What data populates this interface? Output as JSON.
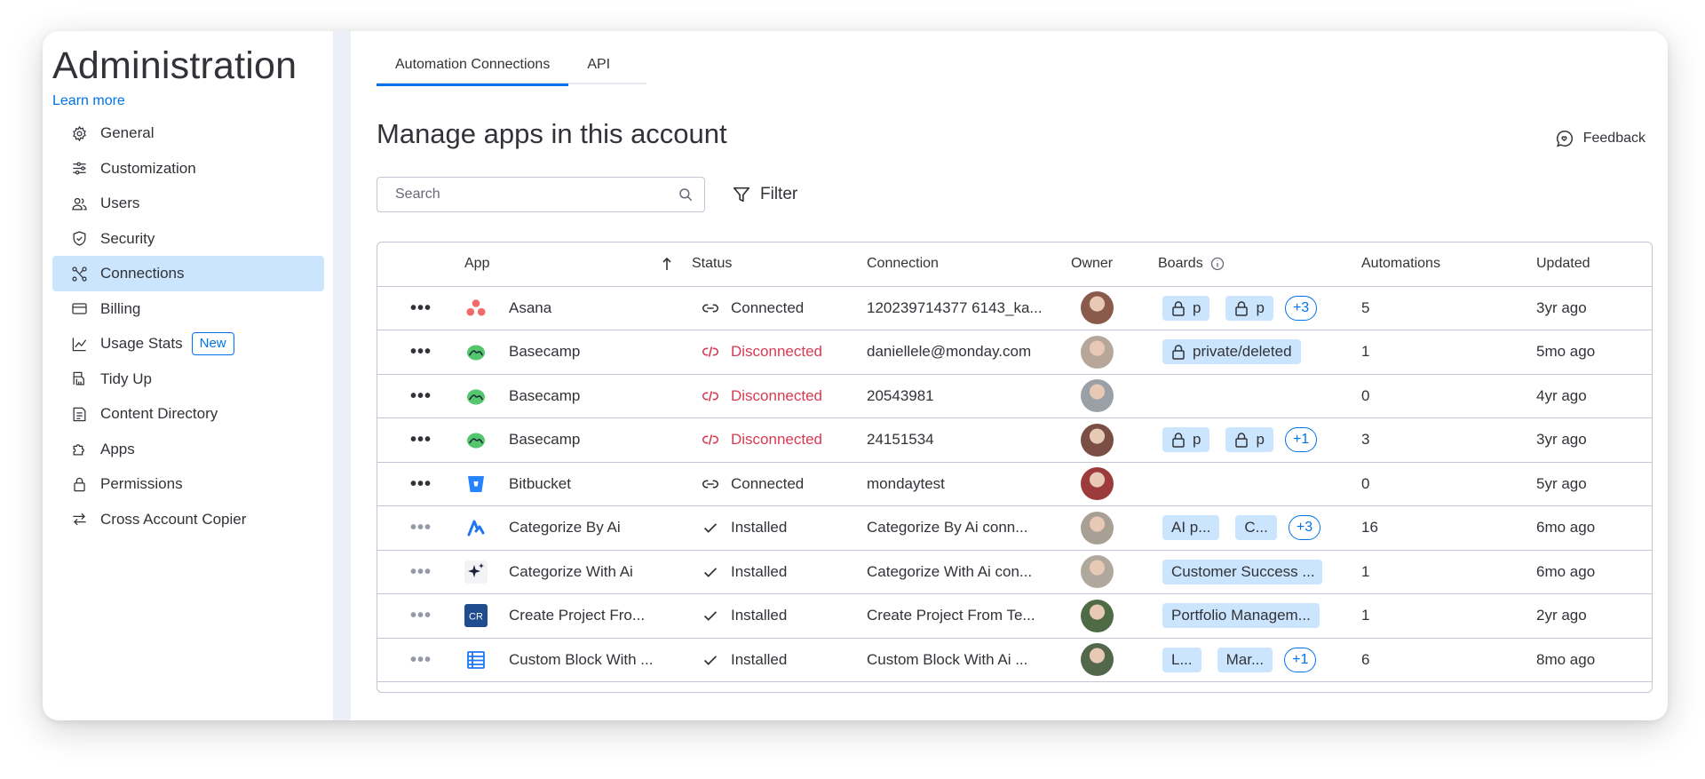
{
  "sidebar": {
    "title": "Administration",
    "learn_more": "Learn more",
    "items": [
      {
        "label": "General",
        "icon": "gear-icon"
      },
      {
        "label": "Customization",
        "icon": "sliders-icon"
      },
      {
        "label": "Users",
        "icon": "users-icon"
      },
      {
        "label": "Security",
        "icon": "shield-icon"
      },
      {
        "label": "Connections",
        "icon": "connections-icon",
        "active": true
      },
      {
        "label": "Billing",
        "icon": "credit-card-icon"
      },
      {
        "label": "Usage Stats",
        "icon": "chart-icon",
        "badge": "New"
      },
      {
        "label": "Tidy Up",
        "icon": "broom-icon"
      },
      {
        "label": "Content Directory",
        "icon": "directory-icon"
      },
      {
        "label": "Apps",
        "icon": "puzzle-icon"
      },
      {
        "label": "Permissions",
        "icon": "lock-icon"
      },
      {
        "label": "Cross Account Copier",
        "icon": "transfer-icon"
      }
    ]
  },
  "tabs": [
    {
      "label": "Automation Connections",
      "active": true
    },
    {
      "label": "API"
    }
  ],
  "page_title": "Manage apps in this account",
  "feedback_label": "Feedback",
  "search": {
    "placeholder": "Search",
    "value": ""
  },
  "filter_label": "Filter",
  "table": {
    "headers": {
      "app": "App",
      "status": "Status",
      "connection": "Connection",
      "owner": "Owner",
      "boards": "Boards",
      "automations": "Automations",
      "updated": "Updated"
    },
    "rows": [
      {
        "app": "Asana",
        "app_icon": "asana-icon",
        "status": "Connected",
        "status_type": "connected",
        "connection": "120239714377 6143_ka...",
        "boards": [
          "p",
          "p"
        ],
        "boards_locked": true,
        "boards_more": "+3",
        "automations": "5",
        "updated": "3yr ago",
        "dots_dim": false
      },
      {
        "app": "Basecamp",
        "app_icon": "basecamp-icon",
        "status": "Disconnected",
        "status_type": "disconnected",
        "connection": "daniellele@monday.com",
        "boards": [
          "private/deleted"
        ],
        "boards_locked": true,
        "boards_more": "",
        "automations": "1",
        "updated": "5mo ago",
        "dots_dim": false
      },
      {
        "app": "Basecamp",
        "app_icon": "basecamp-icon",
        "status": "Disconnected",
        "status_type": "disconnected",
        "connection": "20543981",
        "boards": [],
        "boards_locked": false,
        "boards_more": "",
        "automations": "0",
        "updated": "4yr ago",
        "dots_dim": false
      },
      {
        "app": "Basecamp",
        "app_icon": "basecamp-icon",
        "status": "Disconnected",
        "status_type": "disconnected",
        "connection": "24151534",
        "boards": [
          "p",
          "p"
        ],
        "boards_locked": true,
        "boards_more": "+1",
        "automations": "3",
        "updated": "3yr ago",
        "dots_dim": false
      },
      {
        "app": "Bitbucket",
        "app_icon": "bitbucket-icon",
        "status": "Connected",
        "status_type": "connected",
        "connection": "mondaytest",
        "boards": [],
        "boards_locked": false,
        "boards_more": "",
        "automations": "0",
        "updated": "5yr ago",
        "dots_dim": false
      },
      {
        "app": "Categorize By Ai",
        "app_icon": "categorize-by-ai-icon",
        "status": "Installed",
        "status_type": "installed",
        "connection": "Categorize By Ai conn...",
        "boards": [
          "AI p...",
          "C..."
        ],
        "boards_locked": false,
        "boards_more": "+3",
        "automations": "16",
        "updated": "6mo ago",
        "dots_dim": true
      },
      {
        "app": "Categorize With Ai",
        "app_icon": "sparkle-icon",
        "status": "Installed",
        "status_type": "installed",
        "connection": "Categorize With Ai con...",
        "boards": [
          "Customer Success ..."
        ],
        "boards_locked": false,
        "boards_more": "",
        "automations": "1",
        "updated": "6mo ago",
        "dots_dim": true
      },
      {
        "app": "Create Project Fro...",
        "app_icon": "cr-icon",
        "app_icon_text": "CR",
        "status": "Installed",
        "status_type": "installed",
        "connection": "Create Project From Te...",
        "boards": [
          "Portfolio Managem..."
        ],
        "boards_locked": false,
        "boards_more": "",
        "automations": "1",
        "updated": "2yr ago",
        "dots_dim": true
      },
      {
        "app": "Custom Block With ...",
        "app_icon": "table-icon",
        "status": "Installed",
        "status_type": "installed",
        "connection": "Custom Block With Ai ...",
        "boards": [
          "L...",
          "Mar..."
        ],
        "boards_locked": false,
        "boards_more": "+1",
        "automations": "6",
        "updated": "8mo ago",
        "dots_dim": true
      }
    ]
  },
  "colors": {
    "accent": "#0073ea",
    "active_bg": "#cce5ff",
    "disconnected": "#d83a52",
    "border": "#c3c6d4"
  }
}
